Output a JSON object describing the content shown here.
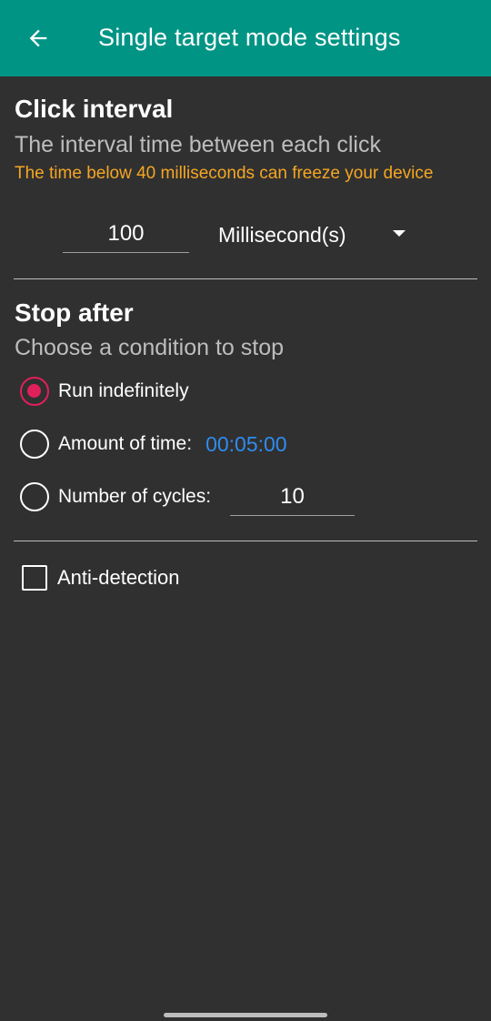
{
  "appbar": {
    "title": "Single target mode settings",
    "back_icon": "arrow-left-icon",
    "background": "#009485"
  },
  "click_interval": {
    "title": "Click interval",
    "subtitle": "The interval time between each click",
    "warning": "The time below 40 milliseconds can freeze your device",
    "value": "100",
    "unit": "Millisecond(s)"
  },
  "stop_after": {
    "title": "Stop after",
    "subtitle": "Choose a condition to stop",
    "options": [
      {
        "label": "Run indefinitely",
        "selected": true
      },
      {
        "label": "Amount of time:",
        "selected": false,
        "value": "00:05:00"
      },
      {
        "label": "Number of cycles:",
        "selected": false,
        "value": "10"
      }
    ]
  },
  "anti_detection": {
    "label": "Anti-detection",
    "checked": false
  },
  "colors": {
    "accent": "#e0205a",
    "warning": "#f5a623",
    "link": "#2f8cf0"
  }
}
